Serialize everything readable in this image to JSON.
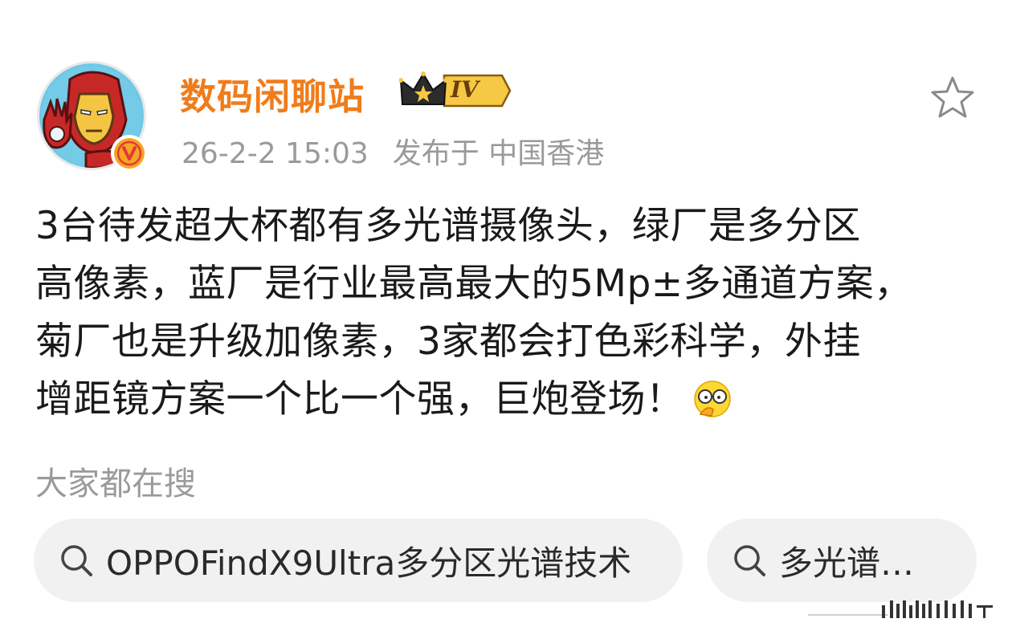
{
  "post": {
    "author": {
      "name": "数码闲聊站",
      "level": "IV",
      "avatar_icon": "ironman-avatar",
      "verified_icon": "verified-v-icon"
    },
    "meta": {
      "timestamp": "26-2-2 15:03",
      "location": "发布于 中国香港"
    },
    "text_lines": [
      "3台待发超大杯都有多光谱摄像头，绿厂是多分区",
      "高像素，蓝厂是行业最高最大的5Mp±多通道方案，",
      "菊厂也是升级加像素，3家都会打色彩科学，外挂",
      "增距镜方案一个比一个强，巨炮登场！"
    ],
    "emoji_icon": "glasses-emoji-icon",
    "favorite_icon": "star-outline-icon"
  },
  "search": {
    "label": "大家都在搜",
    "chips": [
      {
        "icon": "search-icon",
        "text": "OPPOFindX9Ultra多分区光谱技术"
      },
      {
        "icon": "search-icon",
        "text": "多光谱…"
      }
    ]
  },
  "colors": {
    "username": "#f07c1b",
    "meta": "#9a9a9a",
    "text": "#1a1a1a",
    "chip_bg": "#f1f1f1",
    "verified": "#f5a623"
  }
}
